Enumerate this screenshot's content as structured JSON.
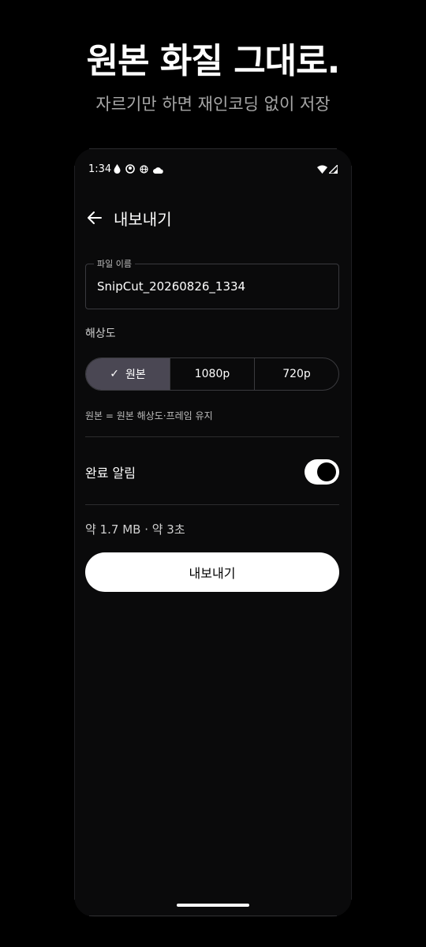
{
  "promo": {
    "title": "원본 화질 그대로.",
    "subtitle": "자르기만 하면 재인코딩 없이 저장"
  },
  "status_bar": {
    "time": "1:34",
    "left_icons": [
      "water-drop-icon",
      "face-icon",
      "globe-icon",
      "cloud-icon"
    ],
    "right_icons": [
      "wifi-icon",
      "signal-icon"
    ]
  },
  "header": {
    "title": "내보내기",
    "back_icon": "arrow-left-icon"
  },
  "filename": {
    "label": "파일 이름",
    "value": "SnipCut_20260826_1334"
  },
  "resolution": {
    "label": "해상도",
    "options": [
      {
        "label": "원본",
        "selected": true
      },
      {
        "label": "1080p",
        "selected": false
      },
      {
        "label": "720p",
        "selected": false
      }
    ],
    "note": "원본 = 원본 해상도·프레임 유지"
  },
  "notify": {
    "label": "완료 알림",
    "enabled": true
  },
  "estimate": "약 1.7 MB · 약 3초",
  "export_button": "내보내기",
  "colors": {
    "background": "#000000",
    "screen": "#0a0a0b",
    "selected_segment": "#4a4753",
    "button": "#ffffff"
  }
}
